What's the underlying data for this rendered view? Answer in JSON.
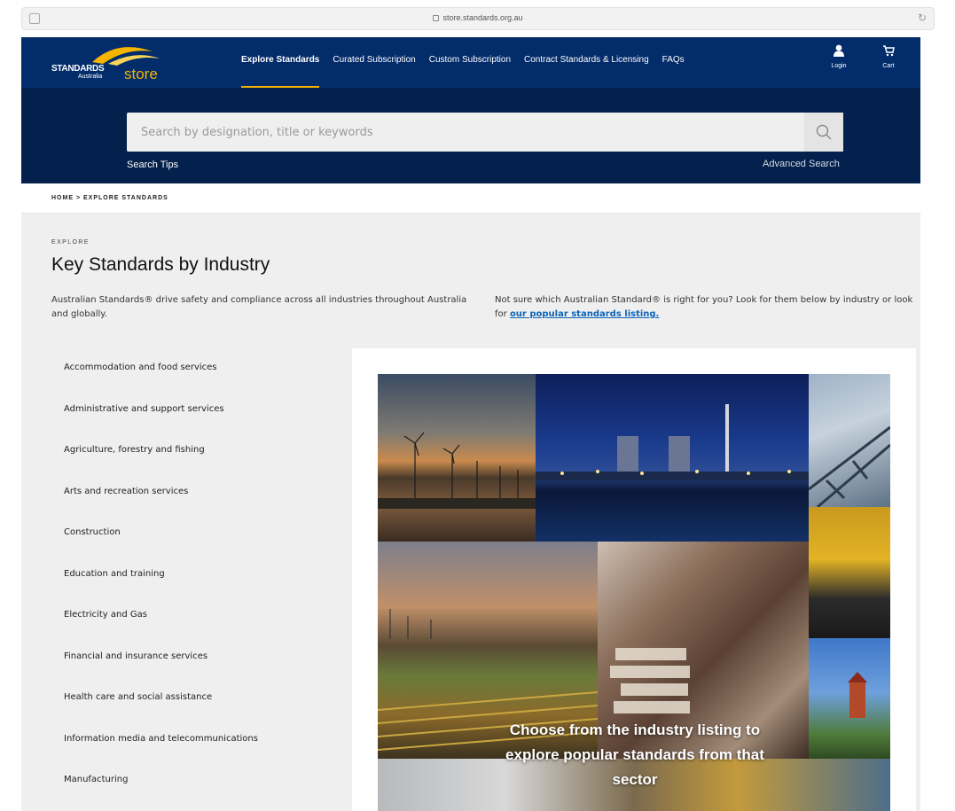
{
  "browser": {
    "url": "store.standards.org.au"
  },
  "brand": {
    "line1": "STANDARDS",
    "line2": "Australia",
    "line3": "store"
  },
  "nav": [
    {
      "label": "Explore Standards"
    },
    {
      "label": "Curated Subscription"
    },
    {
      "label": "Custom Subscription"
    },
    {
      "label": "Contract Standards & Licensing"
    },
    {
      "label": "FAQs"
    }
  ],
  "header_actions": {
    "login": "Login",
    "cart": "Cart"
  },
  "search": {
    "placeholder": "Search by designation, title or keywords",
    "tips": "Search Tips",
    "advanced": "Advanced Search"
  },
  "breadcrumb": "HOME  >  EXPLORE STANDARDS",
  "page": {
    "eyebrow": "EXPLORE",
    "title": "Key Standards by Industry",
    "intro": "Australian Standards® drive safety and compliance across all industries throughout Australia and globally.",
    "intro2": "Not sure which Australian Standard® is right for you? Look for them below by industry or look for",
    "intro2_link": "our popular standards listing."
  },
  "industries": [
    "Accommodation and food services",
    "Administrative and support services",
    "Agriculture, forestry and fishing",
    "Arts and recreation services",
    "Construction",
    "Education and training",
    "Electricity and Gas",
    "Financial and insurance services",
    "Health care and social assistance",
    "Information media and telecommunications",
    "Manufacturing"
  ],
  "hero": {
    "caption": "Choose from the industry listing to explore popular standards from that sector"
  },
  "colors": {
    "navy": "#032c6b",
    "dark_navy": "#03214c",
    "gold": "#f4b400",
    "link": "#0b63b7"
  }
}
